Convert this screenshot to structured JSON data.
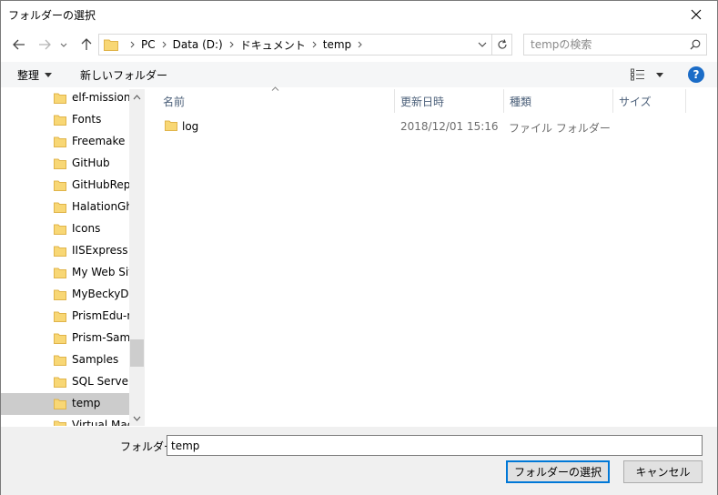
{
  "window": {
    "title": "フォルダーの選択"
  },
  "address": {
    "crumbs": [
      "PC",
      "Data (D:)",
      "ドキュメント",
      "temp"
    ]
  },
  "search": {
    "placeholder": "tempの検索"
  },
  "toolbar": {
    "organize_label": "整理",
    "new_folder_label": "新しいフォルダー",
    "help_label": "?"
  },
  "navpane": {
    "items": [
      {
        "label": "elf-mission_"
      },
      {
        "label": "Fonts"
      },
      {
        "label": "Freemake"
      },
      {
        "label": "GitHub"
      },
      {
        "label": "GitHubRepo"
      },
      {
        "label": "HalationGho"
      },
      {
        "label": "Icons"
      },
      {
        "label": "IISExpress"
      },
      {
        "label": "My Web Site"
      },
      {
        "label": "MyBeckyDa"
      },
      {
        "label": "PrismEdu-m"
      },
      {
        "label": "Prism-Samp"
      },
      {
        "label": "Samples"
      },
      {
        "label": "SQL Server M"
      },
      {
        "label": "temp",
        "selected": true
      },
      {
        "label": "Virtual Mach"
      }
    ]
  },
  "filelist": {
    "columns": [
      "名前",
      "更新日時",
      "種類",
      "サイズ"
    ],
    "rows": [
      {
        "name": "log",
        "modified": "2018/12/01 15:16",
        "type": "ファイル フォルダー"
      }
    ]
  },
  "footer": {
    "folder_label": "フォルダー:",
    "folder_value": "temp",
    "select_button": "フォルダーの選択",
    "cancel_button": "キャンセル"
  },
  "colors": {
    "folder_yellow": "#f8d775",
    "accent_blue": "#0078d7",
    "selected_bg": "#cccccc"
  }
}
